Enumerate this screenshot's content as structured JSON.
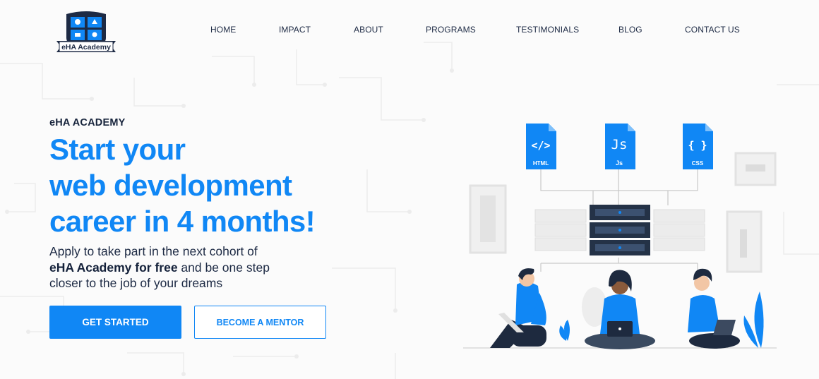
{
  "brand": {
    "logo_text": "eHA Academy"
  },
  "nav": {
    "items": [
      {
        "label": "HOME"
      },
      {
        "label": "IMPACT"
      },
      {
        "label": "ABOUT"
      },
      {
        "label": "PROGRAMS"
      },
      {
        "label": "TESTIMONIALS"
      },
      {
        "label": "BLOG"
      },
      {
        "label": "CONTACT US"
      }
    ]
  },
  "hero": {
    "eyebrow": "eHA ACADEMY",
    "title_line1": "Start your",
    "title_line2": "web development",
    "title_line3": "career in 4 months!",
    "desc_line1": "Apply to take part in the next cohort of",
    "desc_bold": "eHA Academy for free",
    "desc_line2_rest": " and be one step",
    "desc_line3": "closer to the job of your dreams"
  },
  "buttons": {
    "primary": "GET STARTED",
    "secondary": "BECOME A MENTOR"
  },
  "illustration": {
    "files": [
      {
        "glyph": "</>",
        "label": "HTML"
      },
      {
        "glyph": "Js",
        "label": "Js"
      },
      {
        "glyph": "{ }",
        "label": "CSS"
      }
    ]
  },
  "colors": {
    "accent": "#1087f5",
    "text": "#1d2a44",
    "server": "#243247"
  }
}
